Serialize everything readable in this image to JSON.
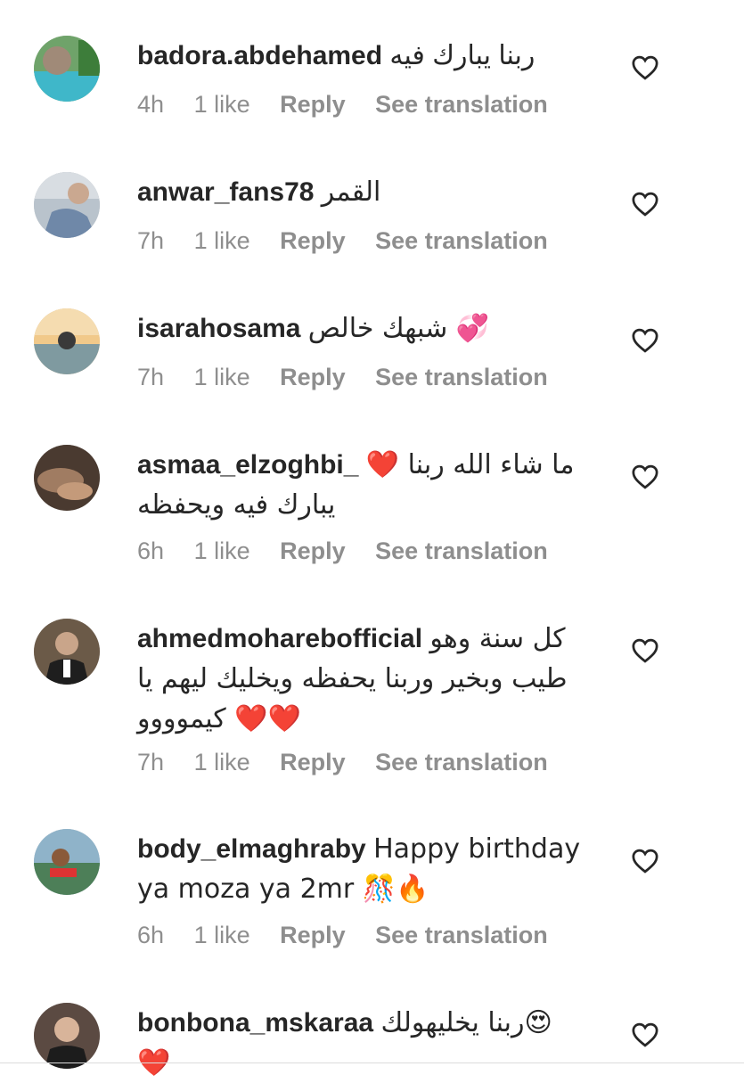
{
  "comments": [
    {
      "username": "badora.abdehamed",
      "text": "ربنا يبارك فيه",
      "time": "4h",
      "likes": "1 like",
      "reply": "Reply",
      "see_translation": "See translation",
      "avatar": "nature-landscape-avatar"
    },
    {
      "username": "anwar_fans78",
      "text": "القمر",
      "time": "7h",
      "likes": "1 like",
      "reply": "Reply",
      "see_translation": "See translation",
      "avatar": "person-photo-avatar"
    },
    {
      "username": "isarahosama",
      "text": "شبهك خالص 💞",
      "time": "7h",
      "likes": "1 like",
      "reply": "Reply",
      "see_translation": "See translation",
      "avatar": "sunset-water-avatar"
    },
    {
      "username": "asmaa_elzoghbi_",
      "text": "ما شاء الله ربنا ❤️ يبارك فيه ويحفظه",
      "time": "6h",
      "likes": "1 like",
      "reply": "Reply",
      "see_translation": "See translation",
      "avatar": "hands-photo-avatar"
    },
    {
      "username": "ahmedmoharebofficial",
      "text": "كل سنة وهو طيب وبخير وربنا يحفظه ويخليك ليهم يا كيموووو ❤️❤️",
      "time": "7h",
      "likes": "1 like",
      "reply": "Reply",
      "see_translation": "See translation",
      "avatar": "man-suit-avatar"
    },
    {
      "username": "body_elmaghraby",
      "text": "Happy birthday ya moza ya 2mr 🎊🔥",
      "time": "6h",
      "likes": "1 like",
      "reply": "Reply",
      "see_translation": "See translation",
      "avatar": "jetski-avatar"
    },
    {
      "username": "bonbona_mskaraa",
      "text": "ربنا يخليهولك😍❤️",
      "time": "",
      "likes": "",
      "reply": "",
      "see_translation": "",
      "avatar": "woman-portrait-avatar"
    }
  ],
  "colors": {
    "text": "#262626",
    "meta": "#8e8e8e",
    "heart": "#262626"
  }
}
